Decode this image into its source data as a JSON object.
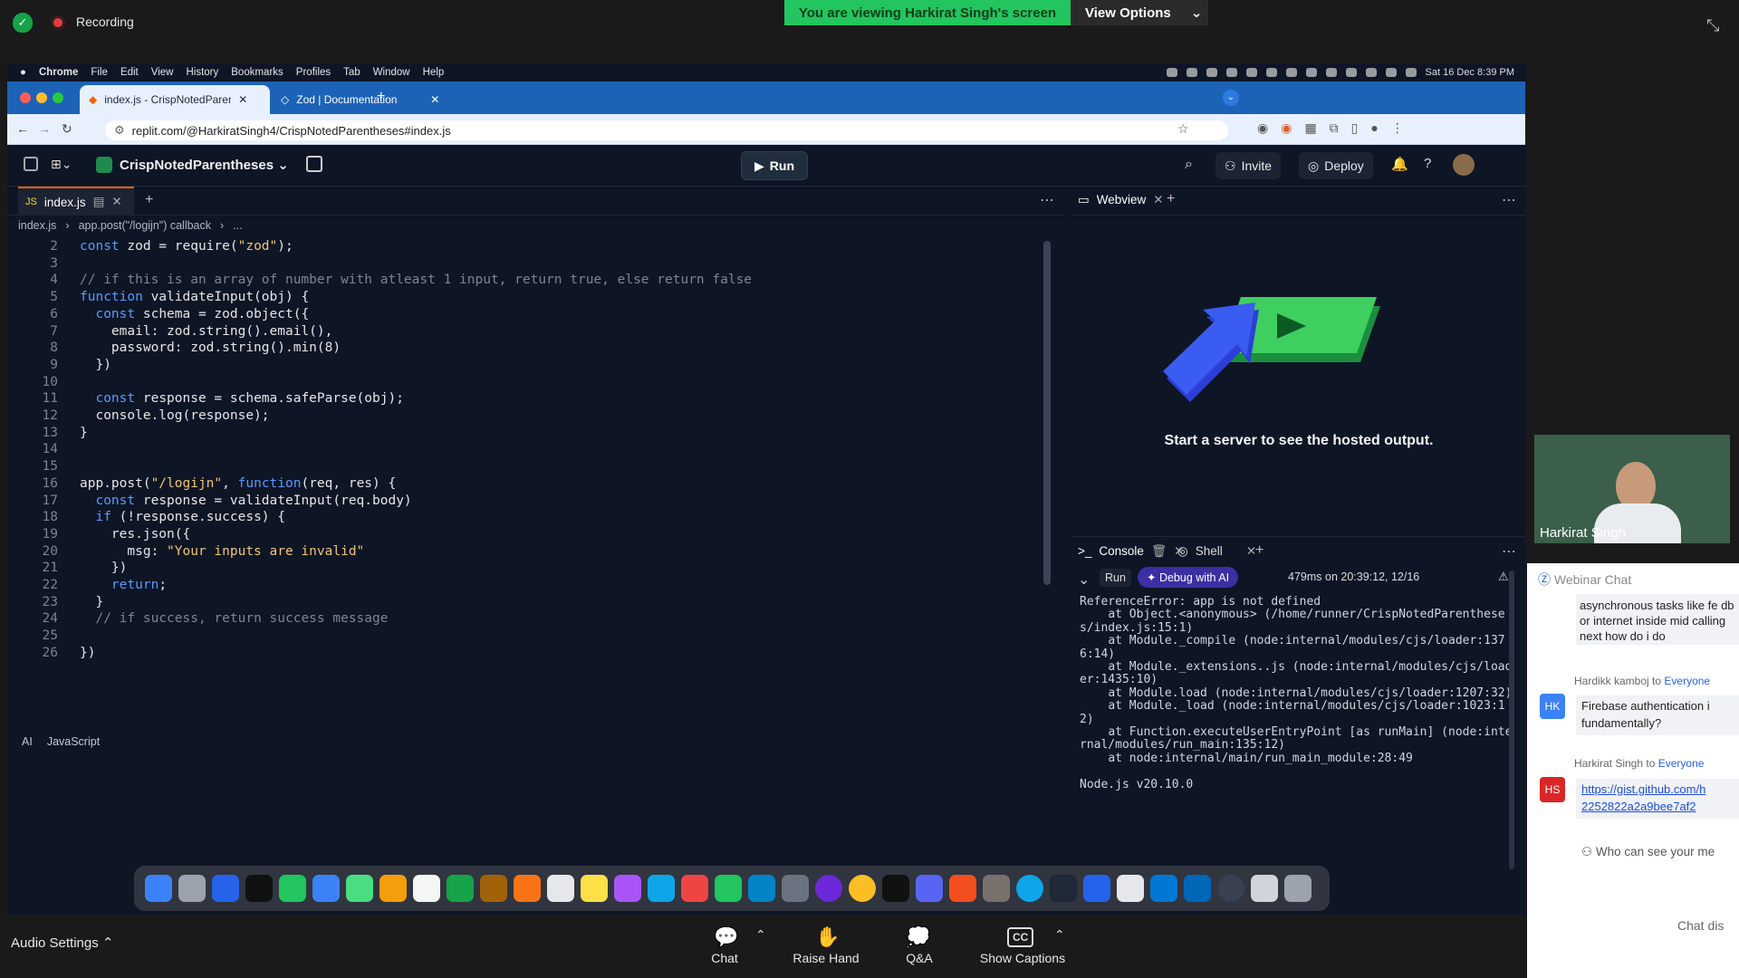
{
  "zoom": {
    "recording": "Recording",
    "viewing_banner": "You are viewing Harkirat Singh's screen",
    "view_options": "View Options",
    "audio_settings": "Audio Settings",
    "bottom_buttons": [
      "Chat",
      "Raise Hand",
      "Q&A",
      "Show Captions"
    ],
    "webcam_name": "Harkirat Singh"
  },
  "mac_menu": {
    "items": [
      "Chrome",
      "File",
      "Edit",
      "View",
      "History",
      "Bookmarks",
      "Profiles",
      "Tab",
      "Window",
      "Help"
    ],
    "datetime": "Sat 16 Dec  8:39 PM"
  },
  "browser": {
    "tabs": [
      "index.js - CrispNotedParenth",
      "Zod | Documentation"
    ],
    "url": "replit.com/@HarkiratSingh4/CrispNotedParentheses#index.js"
  },
  "replit": {
    "project": "CrispNotedParentheses",
    "run": "Run",
    "invite": "Invite",
    "deploy": "Deploy",
    "file_tab": "index.js",
    "breadcrumb": [
      "index.js",
      "app.post(\"/logijn\") callback",
      "..."
    ],
    "webview_tab": "Webview",
    "start_msg": "Start a server to see the hosted output.",
    "console_tab": "Console",
    "shell_tab": "Shell",
    "console_run": "Run",
    "debug_ai": "Debug with AI",
    "timing": "479ms on 20:39:12, 12/16",
    "console_output": "ReferenceError: app is not defined\n    at Object.<anonymous> (/home/runner/CrispNotedParentheses/index.js:15:1)\n    at Module._compile (node:internal/modules/cjs/loader:1376:14)\n    at Module._extensions..js (node:internal/modules/cjs/loader:1435:10)\n    at Module.load (node:internal/modules/cjs/loader:1207:32)\n    at Module._load (node:internal/modules/cjs/loader:1023:12)\n    at Function.executeUserEntryPoint [as runMain] (node:internal/modules/run_main:135:12)\n    at node:internal/main/run_main_module:28:49\n\nNode.js v20.10.0",
    "status_ai": "AI",
    "status_lang": "JavaScript"
  },
  "code_lines": [
    {
      "n": "2",
      "t": "const zod = require(\"zod\");"
    },
    {
      "n": "3",
      "t": ""
    },
    {
      "n": "4",
      "t": "// if this is an array of number with atleast 1 input, return true, else return false"
    },
    {
      "n": "5",
      "t": "function validateInput(obj) {"
    },
    {
      "n": "6",
      "t": "  const schema = zod.object({"
    },
    {
      "n": "7",
      "t": "    email: zod.string().email(),"
    },
    {
      "n": "8",
      "t": "    password: zod.string().min(8)"
    },
    {
      "n": "9",
      "t": "  })"
    },
    {
      "n": "10",
      "t": ""
    },
    {
      "n": "11",
      "t": "  const response = schema.safeParse(obj);"
    },
    {
      "n": "12",
      "t": "  console.log(response);"
    },
    {
      "n": "13",
      "t": "}"
    },
    {
      "n": "14",
      "t": ""
    },
    {
      "n": "15",
      "t": ""
    },
    {
      "n": "16",
      "t": "app.post(\"/logijn\", function(req, res) {"
    },
    {
      "n": "17",
      "t": "  const response = validateInput(req.body)"
    },
    {
      "n": "18",
      "t": "  if (!response.success) {"
    },
    {
      "n": "19",
      "t": "    res.json({"
    },
    {
      "n": "20",
      "t": "      msg: \"Your inputs are invalid\""
    },
    {
      "n": "21",
      "t": "    })"
    },
    {
      "n": "22",
      "t": "    return;"
    },
    {
      "n": "23",
      "t": "  }"
    },
    {
      "n": "24",
      "t": "  // if success, return success message"
    },
    {
      "n": "25",
      "t": ""
    },
    {
      "n": "26",
      "t": "})"
    }
  ],
  "chat": {
    "title": "Webinar Chat",
    "msg0": "asynchronous tasks like fe db or internet inside mid calling next how do i do",
    "from1": "Hardikk kamboj",
    "to1": "Everyone",
    "initials1": "HK",
    "msg1": "Firebase authentication i fundamentally?",
    "from2": "Harkirat Singh",
    "to2": "Everyone",
    "initials2": "HS",
    "msg2": "https://gist.github.com/h 2252822a2a9bee7af2",
    "who": "Who can see your me",
    "footer": "Chat dis",
    "to_word": "to"
  }
}
